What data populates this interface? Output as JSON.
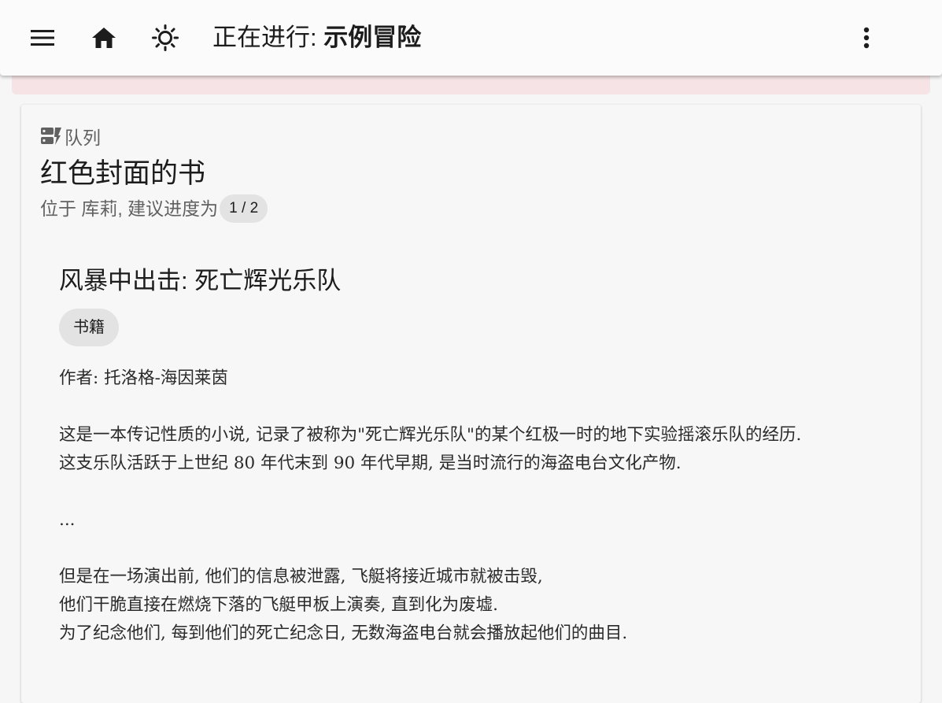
{
  "appbar": {
    "menu_icon": "menu-icon",
    "home_icon": "home-icon",
    "theme_icon": "brightness-icon",
    "more_icon": "more-vert-icon",
    "title_prefix": "正在进行: ",
    "title_bold": "示例冒险"
  },
  "card": {
    "overline_icon": "queue-icon",
    "overline": "队列",
    "title": "红色封面的书",
    "subtitle": "位于 库莉, 建议进度为",
    "progress": "1 / 2",
    "item": {
      "title": "风暴中出击: 死亡辉光乐队",
      "tag": "书籍",
      "lines": [
        "作者: 托洛格-海因莱茵",
        "",
        "这是一本传记性质的小说, 记录了被称为\"死亡辉光乐队\"的某个红极一时的地下实验摇滚乐队的经历.",
        "这支乐队活跃于上世纪 80 年代末到 90 年代早期, 是当时流行的海盗电台文化产物.",
        "",
        "...",
        "",
        "但是在一场演出前, 他们的信息被泄露, 飞艇将接近城市就被击毁,",
        "他们干脆直接在燃烧下落的飞艇甲板上演奏, 直到化为废墟.",
        "为了纪念他们, 每到他们的死亡纪念日, 无数海盗电台就会播放起他们的曲目."
      ]
    }
  },
  "colors": {
    "alert_strip": "#f5e3e5",
    "chip_bg": "#e3e3e3",
    "appbar_bg": "#fbfbfb"
  }
}
